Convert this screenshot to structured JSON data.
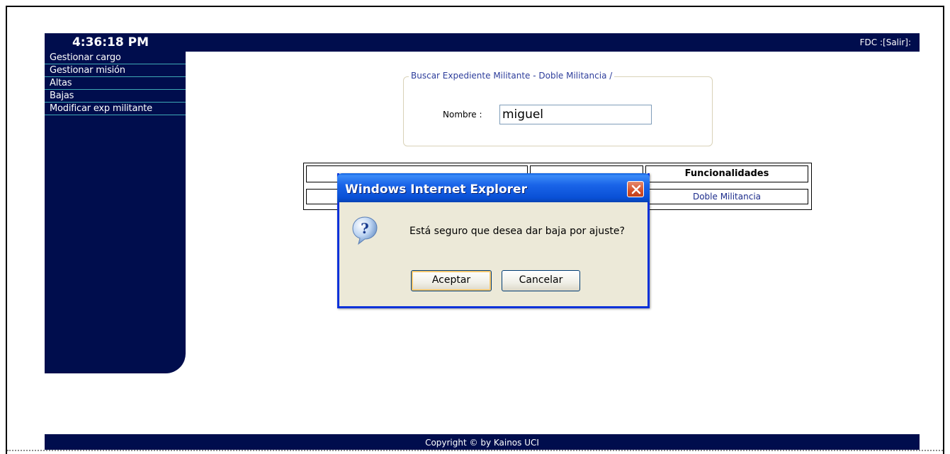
{
  "header": {
    "clock": "4:36:18 PM",
    "user_info": "FDC :[Salir]:"
  },
  "sidebar": {
    "items": [
      {
        "label": "Gestionar cargo"
      },
      {
        "label": "Gestionar misión"
      },
      {
        "label": "Altas"
      },
      {
        "label": "Bajas"
      },
      {
        "label": "Modificar exp militante"
      }
    ]
  },
  "search": {
    "legend": "Buscar Expediente Militante - Doble Militancia /",
    "label": "Nombre :",
    "value": "miguel"
  },
  "results": {
    "header_label": "Funcionalidades",
    "link_label": "Doble Militancia"
  },
  "dialog": {
    "title": "Windows Internet Explorer",
    "message": "Está seguro que desea dar baja por ajuste?",
    "accept_label": "Aceptar",
    "cancel_label": "Cancelar",
    "icon": "question-icon"
  },
  "footer": {
    "copyright": "Copyright © by Kainos UCI"
  },
  "colors": {
    "nav_bg": "#000d4d",
    "menu_divider": "#3ea9b5",
    "link": "#1b2b8b",
    "dialog_titlebar": "#0950d6",
    "dialog_bg": "#ece9d8",
    "close_button": "#d6512a"
  }
}
